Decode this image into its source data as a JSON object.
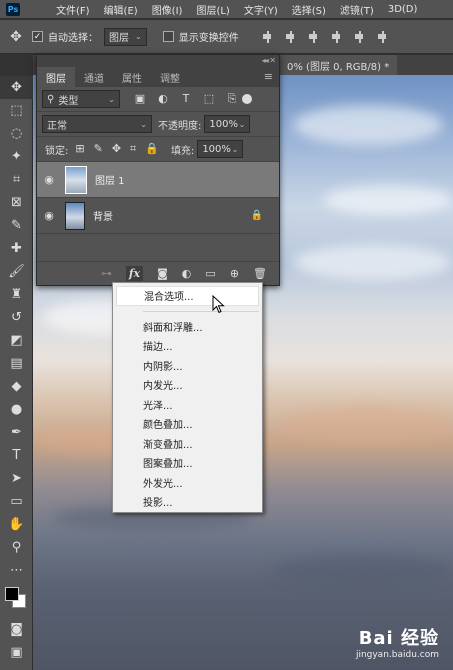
{
  "menubar": {
    "logo": "Ps",
    "items": [
      "文件(F)",
      "编辑(E)",
      "图像(I)",
      "图层(L)",
      "文字(Y)",
      "选择(S)",
      "滤镜(T)",
      "3D(D)"
    ]
  },
  "options": {
    "auto_select_label": "自动选择：",
    "auto_select_value": "图层",
    "show_transform_label": "显示变换控件"
  },
  "document": {
    "tab_title": "0% (图层 0, RGB/8) *"
  },
  "layers_panel": {
    "tabs": [
      "图层",
      "通道",
      "属性",
      "调整"
    ],
    "active_tab": 0,
    "filter_label": "类型",
    "blend_mode": "正常",
    "opacity_label": "不透明度:",
    "opacity_value": "100%",
    "lock_label": "锁定:",
    "fill_label": "填充:",
    "fill_value": "100%",
    "layers": [
      {
        "name": "图层 1",
        "selected": true,
        "locked": false
      },
      {
        "name": "背景",
        "selected": false,
        "locked": true
      }
    ],
    "footer_fx": "fx"
  },
  "context_menu": {
    "items": [
      "混合选项...",
      "斜面和浮雕...",
      "描边...",
      "内阴影...",
      "内发光...",
      "光泽...",
      "颜色叠加...",
      "渐变叠加...",
      "图案叠加...",
      "外发光...",
      "投影..."
    ]
  },
  "watermark": {
    "main": "Bai 经验",
    "sub": "jingyan.baidu.com"
  },
  "colors": {
    "ui_bg": "#535353",
    "foreground": "#000000",
    "background": "#ffffff"
  }
}
